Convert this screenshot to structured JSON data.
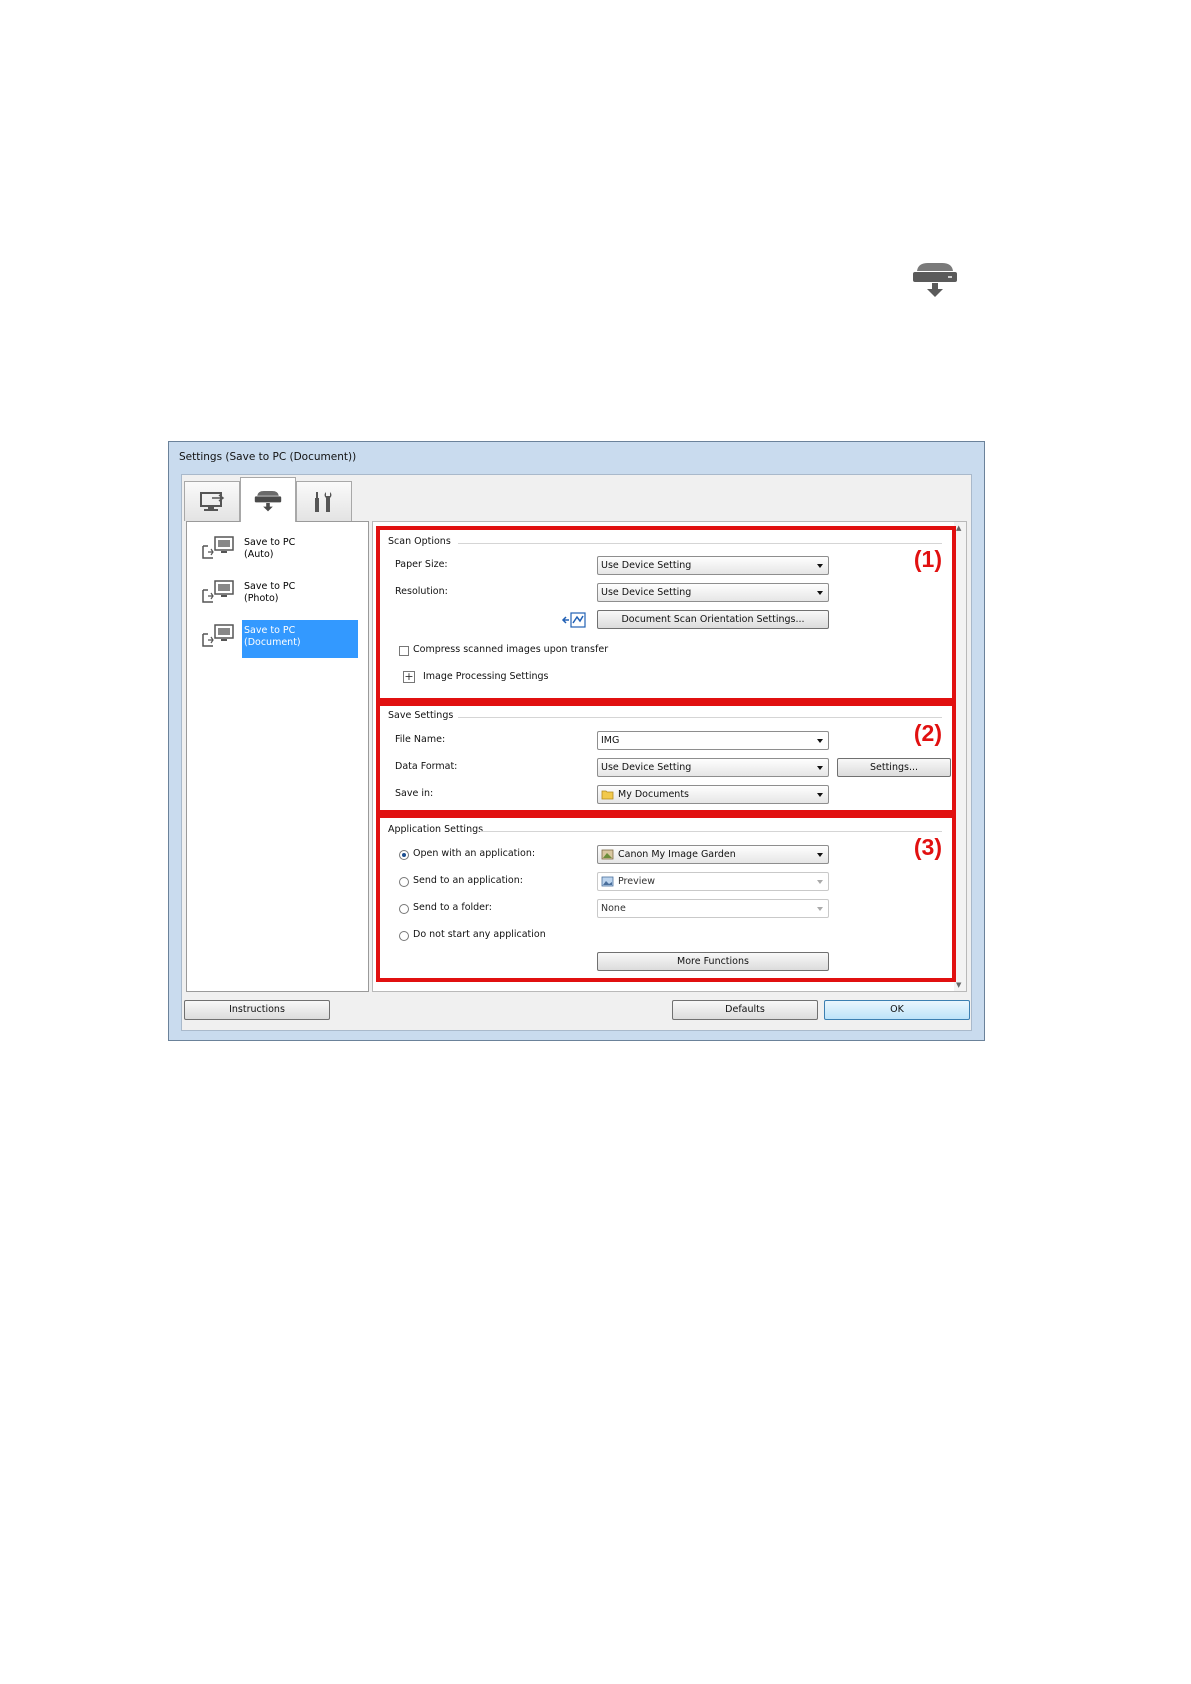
{
  "dialog": {
    "title": "Settings (Save to PC (Document))",
    "tabs": [
      {
        "icon": "computer-icon"
      },
      {
        "icon": "scanner-icon"
      },
      {
        "icon": "tools-icon"
      }
    ]
  },
  "sidebar": {
    "items": [
      {
        "label": "Save to PC\n(Auto)"
      },
      {
        "label": "Save to PC\n(Photo)"
      },
      {
        "label": "Save to PC\n(Document)"
      }
    ]
  },
  "scan_options": {
    "title": "Scan Options",
    "number": "(1)",
    "paper_size_label": "Paper Size:",
    "paper_size_value": "Use Device Setting",
    "resolution_label": "Resolution:",
    "resolution_value": "Use Device Setting",
    "orientation_button": "Document Scan Orientation Settings...",
    "compress_label": "Compress scanned images upon transfer",
    "image_processing_label": "Image Processing Settings",
    "expand_symbol": "+"
  },
  "save_settings": {
    "title": "Save Settings",
    "number": "(2)",
    "file_name_label": "File Name:",
    "file_name_value": "IMG",
    "data_format_label": "Data Format:",
    "data_format_value": "Use Device Setting",
    "settings_button": "Settings...",
    "save_in_label": "Save in:",
    "save_in_value": "My Documents"
  },
  "application_settings": {
    "title": "Application Settings",
    "number": "(3)",
    "open_with_label": "Open with an application:",
    "open_with_value": "Canon My Image Garden",
    "send_to_app_label": "Send to an application:",
    "send_to_app_value": "Preview",
    "send_to_folder_label": "Send to a folder:",
    "send_to_folder_value": "None",
    "do_not_start_label": "Do not start any application",
    "more_functions_button": "More Functions"
  },
  "footer": {
    "instructions_button": "Instructions",
    "defaults_button": "Defaults",
    "ok_button": "OK"
  },
  "colors": {
    "highlight_border": "#e11010",
    "selection": "#3399ff",
    "dialog_frame": "#c9dbee"
  }
}
